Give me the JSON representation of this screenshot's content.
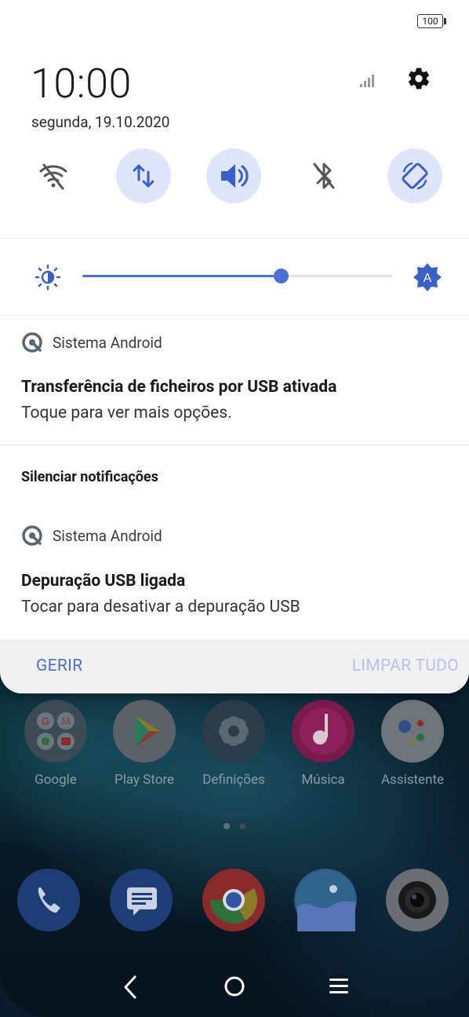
{
  "status_bar": {
    "battery": "100"
  },
  "header": {
    "time": "10:00",
    "date": "segunda, 19.10.2020"
  },
  "quick_settings": [
    {
      "name": "wifi",
      "icon": "wifi-off-icon",
      "active": false
    },
    {
      "name": "mobile-data",
      "icon": "data-transfer-icon",
      "active": true
    },
    {
      "name": "sound",
      "icon": "volume-icon",
      "active": true
    },
    {
      "name": "bluetooth",
      "icon": "bluetooth-off-icon",
      "active": false
    },
    {
      "name": "auto-rotate",
      "icon": "rotate-icon",
      "active": true
    }
  ],
  "brightness": {
    "level": 0.64
  },
  "notifications": [
    {
      "app": "Sistema Android",
      "title": "Transferência de ficheiros por USB ativada",
      "text": "Toque para ver mais opções."
    },
    {
      "app": "Sistema Android",
      "title": "Depuração USB ligada",
      "text": "Tocar para desativar a depuração USB"
    }
  ],
  "silent_section": {
    "label": "Silenciar notificações"
  },
  "footer": {
    "manage_label": "GERIR",
    "clear_label": "LIMPAR TUDO"
  },
  "apps": [
    {
      "label": "Google"
    },
    {
      "label": "Play Store"
    },
    {
      "label": "Definições"
    },
    {
      "label": "Música"
    },
    {
      "label": "Assistente"
    }
  ],
  "colors": {
    "accent": "#4a6fd6",
    "active_tile": "#dfe6fb",
    "disabled_text": "#b8c2e8"
  }
}
